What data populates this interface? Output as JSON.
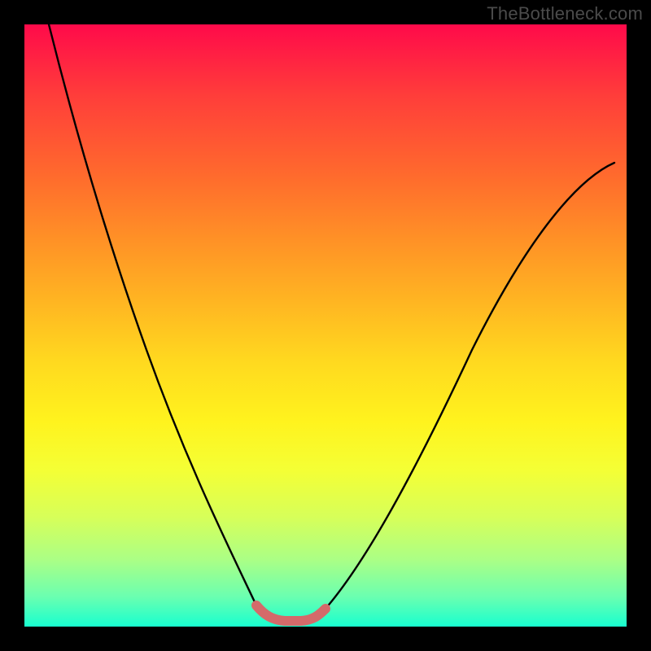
{
  "watermark": "TheBottleneck.com",
  "chart_data": {
    "type": "line",
    "title": "",
    "xlabel": "",
    "ylabel": "",
    "xlim": [
      0,
      1
    ],
    "ylim": [
      0,
      1
    ],
    "grid": false,
    "series": [
      {
        "name": "left-branch",
        "x": [
          0.04,
          0.07,
          0.1,
          0.13,
          0.16,
          0.19,
          0.22,
          0.25,
          0.28,
          0.31,
          0.335,
          0.36,
          0.385
        ],
        "y": [
          1.0,
          0.88,
          0.77,
          0.66,
          0.56,
          0.47,
          0.385,
          0.305,
          0.23,
          0.16,
          0.105,
          0.06,
          0.035
        ]
      },
      {
        "name": "right-branch",
        "x": [
          0.5,
          0.54,
          0.58,
          0.62,
          0.66,
          0.7,
          0.74,
          0.78,
          0.82,
          0.86,
          0.9,
          0.94,
          0.98
        ],
        "y": [
          0.03,
          0.06,
          0.105,
          0.16,
          0.22,
          0.29,
          0.36,
          0.435,
          0.51,
          0.58,
          0.65,
          0.712,
          0.77
        ]
      },
      {
        "name": "valley-highlight",
        "x": [
          0.385,
          0.41,
          0.44,
          0.47,
          0.5
        ],
        "y": [
          0.035,
          0.015,
          0.01,
          0.012,
          0.03
        ]
      }
    ],
    "colors": {
      "branch": "#000000",
      "highlight": "#d46a6a"
    }
  }
}
